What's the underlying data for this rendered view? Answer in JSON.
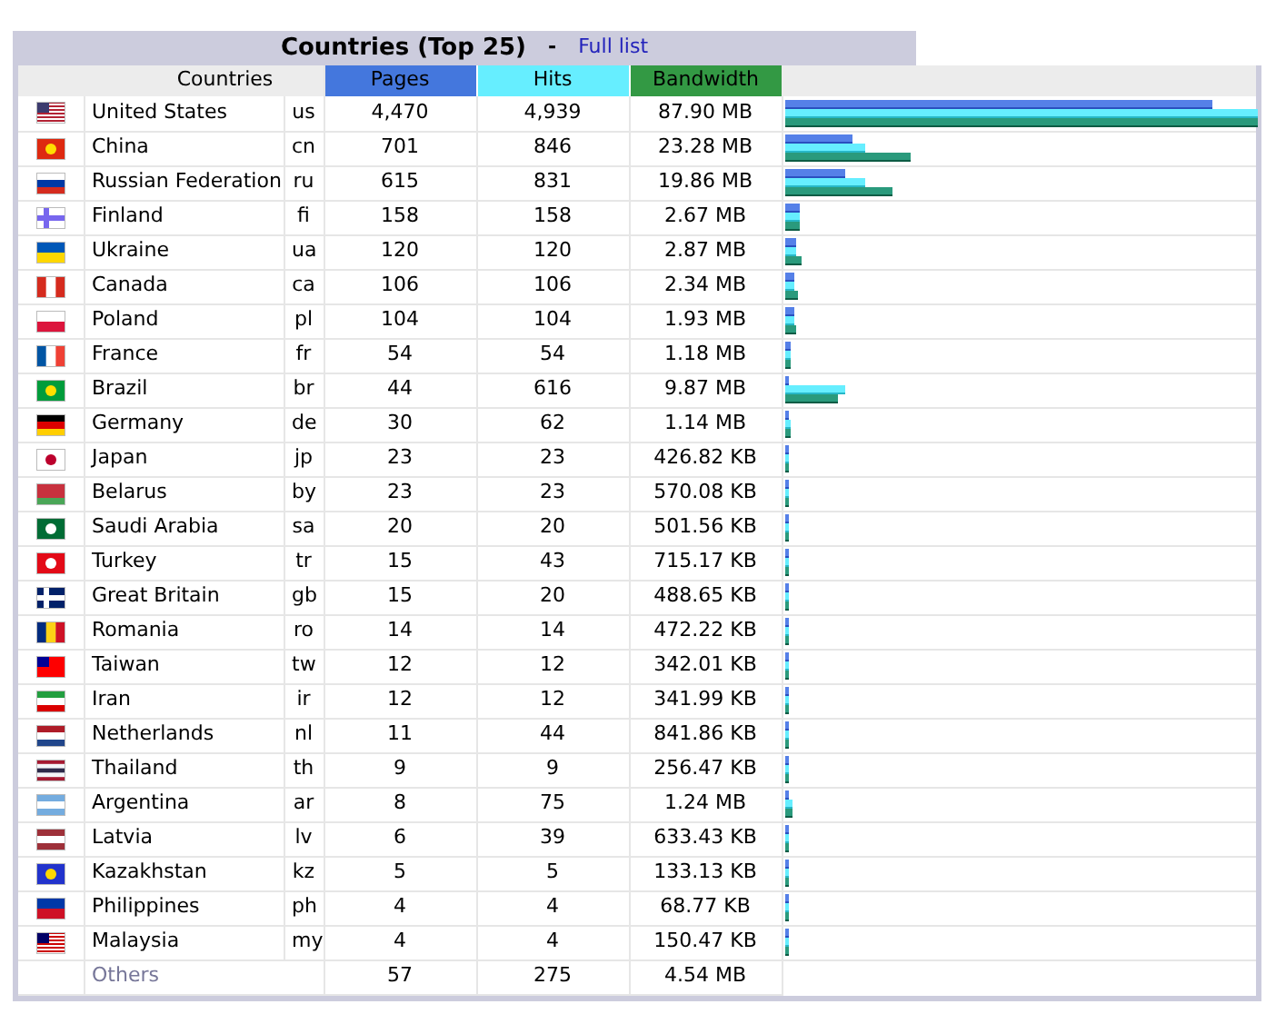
{
  "title": "Countries (Top 25)",
  "separator": "-",
  "full_list_link": "Full list",
  "columns": [
    "Countries",
    "Pages",
    "Hits",
    "Bandwidth"
  ],
  "rows": [
    {
      "name": "United States",
      "code": "us",
      "pages": "4,470",
      "hits": "4,939",
      "bandwidth": "87.90 MB",
      "bars": [
        {
          "kind": "pages",
          "level": 0.905
        },
        {
          "kind": "hits",
          "level": 1
        },
        {
          "kind": "bandwidth",
          "level": 1
        }
      ]
    },
    {
      "name": "China",
      "code": "cn",
      "pages": "701",
      "hits": "846",
      "bandwidth": "23.28 MB",
      "bars": [
        {
          "kind": "pages",
          "level": 0.142
        },
        {
          "kind": "hits",
          "level": 0.171
        },
        {
          "kind": "bandwidth",
          "level": 0.265
        }
      ]
    },
    {
      "name": "Russian Federation",
      "code": "ru",
      "pages": "615",
      "hits": "831",
      "bandwidth": "19.86 MB",
      "bars": [
        {
          "kind": "pages",
          "level": 0.125
        },
        {
          "kind": "hits",
          "level": 0.168
        },
        {
          "kind": "bandwidth",
          "level": 0.226
        }
      ]
    },
    {
      "name": "Finland",
      "code": "fi",
      "pages": "158",
      "hits": "158",
      "bandwidth": "2.67 MB",
      "bars": [
        {
          "kind": "pages",
          "level": 0.032
        },
        {
          "kind": "hits",
          "level": 0.032
        },
        {
          "kind": "bandwidth",
          "level": 0.03
        }
      ]
    },
    {
      "name": "Ukraine",
      "code": "ua",
      "pages": "120",
      "hits": "120",
      "bandwidth": "2.87 MB",
      "bars": [
        {
          "kind": "pages",
          "level": 0.024
        },
        {
          "kind": "hits",
          "level": 0.024
        },
        {
          "kind": "bandwidth",
          "level": 0.033
        }
      ]
    },
    {
      "name": "Canada",
      "code": "ca",
      "pages": "106",
      "hits": "106",
      "bandwidth": "2.34 MB",
      "bars": [
        {
          "kind": "pages",
          "level": 0.021
        },
        {
          "kind": "hits",
          "level": 0.021
        },
        {
          "kind": "bandwidth",
          "level": 0.027
        }
      ]
    },
    {
      "name": "Poland",
      "code": "pl",
      "pages": "104",
      "hits": "104",
      "bandwidth": "1.93 MB",
      "bars": [
        {
          "kind": "pages",
          "level": 0.021
        },
        {
          "kind": "hits",
          "level": 0.021
        },
        {
          "kind": "bandwidth",
          "level": 0.022
        }
      ]
    },
    {
      "name": "France",
      "code": "fr",
      "pages": "54",
      "hits": "54",
      "bandwidth": "1.18 MB",
      "bars": [
        {
          "kind": "pages",
          "level": 0.011
        },
        {
          "kind": "hits",
          "level": 0.011
        },
        {
          "kind": "bandwidth",
          "level": 0.013
        }
      ]
    },
    {
      "name": "Brazil",
      "code": "br",
      "pages": "44",
      "hits": "616",
      "bandwidth": "9.87 MB",
      "bars": [
        {
          "kind": "pages",
          "level": 0.009
        },
        {
          "kind": "hits",
          "level": 0.125
        },
        {
          "kind": "bandwidth",
          "level": 0.112
        }
      ]
    },
    {
      "name": "Germany",
      "code": "de",
      "pages": "30",
      "hits": "62",
      "bandwidth": "1.14 MB",
      "bars": [
        {
          "kind": "pages",
          "level": 0.006
        },
        {
          "kind": "hits",
          "level": 0.013
        },
        {
          "kind": "bandwidth",
          "level": 0.013
        }
      ]
    },
    {
      "name": "Japan",
      "code": "jp",
      "pages": "23",
      "hits": "23",
      "bandwidth": "426.82 KB",
      "bars": [
        {
          "kind": "pages",
          "level": 0.005
        },
        {
          "kind": "hits",
          "level": 0.005
        },
        {
          "kind": "bandwidth",
          "level": 0.005
        }
      ]
    },
    {
      "name": "Belarus",
      "code": "by",
      "pages": "23",
      "hits": "23",
      "bandwidth": "570.08 KB",
      "bars": [
        {
          "kind": "pages",
          "level": 0.005
        },
        {
          "kind": "hits",
          "level": 0.005
        },
        {
          "kind": "bandwidth",
          "level": 0.006
        }
      ]
    },
    {
      "name": "Saudi Arabia",
      "code": "sa",
      "pages": "20",
      "hits": "20",
      "bandwidth": "501.56 KB",
      "bars": [
        {
          "kind": "pages",
          "level": 0.004
        },
        {
          "kind": "hits",
          "level": 0.004
        },
        {
          "kind": "bandwidth",
          "level": 0.006
        }
      ]
    },
    {
      "name": "Turkey",
      "code": "tr",
      "pages": "15",
      "hits": "43",
      "bandwidth": "715.17 KB",
      "bars": [
        {
          "kind": "pages",
          "level": 0.003
        },
        {
          "kind": "hits",
          "level": 0.009
        },
        {
          "kind": "bandwidth",
          "level": 0.008
        }
      ]
    },
    {
      "name": "Great Britain",
      "code": "gb",
      "pages": "15",
      "hits": "20",
      "bandwidth": "488.65 KB",
      "bars": [
        {
          "kind": "pages",
          "level": 0.003
        },
        {
          "kind": "hits",
          "level": 0.004
        },
        {
          "kind": "bandwidth",
          "level": 0.005
        }
      ]
    },
    {
      "name": "Romania",
      "code": "ro",
      "pages": "14",
      "hits": "14",
      "bandwidth": "472.22 KB",
      "bars": [
        {
          "kind": "pages",
          "level": 0.003
        },
        {
          "kind": "hits",
          "level": 0.003
        },
        {
          "kind": "bandwidth",
          "level": 0.005
        }
      ]
    },
    {
      "name": "Taiwan",
      "code": "tw",
      "pages": "12",
      "hits": "12",
      "bandwidth": "342.01 KB",
      "bars": [
        {
          "kind": "pages",
          "level": 0.002
        },
        {
          "kind": "hits",
          "level": 0.002
        },
        {
          "kind": "bandwidth",
          "level": 0.004
        }
      ]
    },
    {
      "name": "Iran",
      "code": "ir",
      "pages": "12",
      "hits": "12",
      "bandwidth": "341.99 KB",
      "bars": [
        {
          "kind": "pages",
          "level": 0.002
        },
        {
          "kind": "hits",
          "level": 0.002
        },
        {
          "kind": "bandwidth",
          "level": 0.004
        }
      ]
    },
    {
      "name": "Netherlands",
      "code": "nl",
      "pages": "11",
      "hits": "44",
      "bandwidth": "841.86 KB",
      "bars": [
        {
          "kind": "pages",
          "level": 0.002
        },
        {
          "kind": "hits",
          "level": 0.009
        },
        {
          "kind": "bandwidth",
          "level": 0.009
        }
      ]
    },
    {
      "name": "Thailand",
      "code": "th",
      "pages": "9",
      "hits": "9",
      "bandwidth": "256.47 KB",
      "bars": [
        {
          "kind": "pages",
          "level": 0.002
        },
        {
          "kind": "hits",
          "level": 0.002
        },
        {
          "kind": "bandwidth",
          "level": 0.003
        }
      ]
    },
    {
      "name": "Argentina",
      "code": "ar",
      "pages": "8",
      "hits": "75",
      "bandwidth": "1.24 MB",
      "bars": [
        {
          "kind": "pages",
          "level": 0.002
        },
        {
          "kind": "hits",
          "level": 0.015
        },
        {
          "kind": "bandwidth",
          "level": 0.014
        }
      ]
    },
    {
      "name": "Latvia",
      "code": "lv",
      "pages": "6",
      "hits": "39",
      "bandwidth": "633.43 KB",
      "bars": [
        {
          "kind": "pages",
          "level": 0.001
        },
        {
          "kind": "hits",
          "level": 0.008
        },
        {
          "kind": "bandwidth",
          "level": 0.007
        }
      ]
    },
    {
      "name": "Kazakhstan",
      "code": "kz",
      "pages": "5",
      "hits": "5",
      "bandwidth": "133.13 KB",
      "bars": [
        {
          "kind": "pages",
          "level": 0.001
        },
        {
          "kind": "hits",
          "level": 0.001
        },
        {
          "kind": "bandwidth",
          "level": 0.002
        }
      ]
    },
    {
      "name": "Philippines",
      "code": "ph",
      "pages": "4",
      "hits": "4",
      "bandwidth": "68.77 KB",
      "bars": [
        {
          "kind": "pages",
          "level": 0.001
        },
        {
          "kind": "hits",
          "level": 0.001
        },
        {
          "kind": "bandwidth",
          "level": 0.001
        }
      ]
    },
    {
      "name": "Malaysia",
      "code": "my",
      "pages": "4",
      "hits": "4",
      "bandwidth": "150.47 KB",
      "bars": [
        {
          "kind": "pages",
          "level": 0.001
        },
        {
          "kind": "hits",
          "level": 0.001
        },
        {
          "kind": "bandwidth",
          "level": 0.002
        }
      ]
    }
  ],
  "others": {
    "name": "Others",
    "pages": "57",
    "hits": "275",
    "bandwidth": "4.54 MB"
  }
}
